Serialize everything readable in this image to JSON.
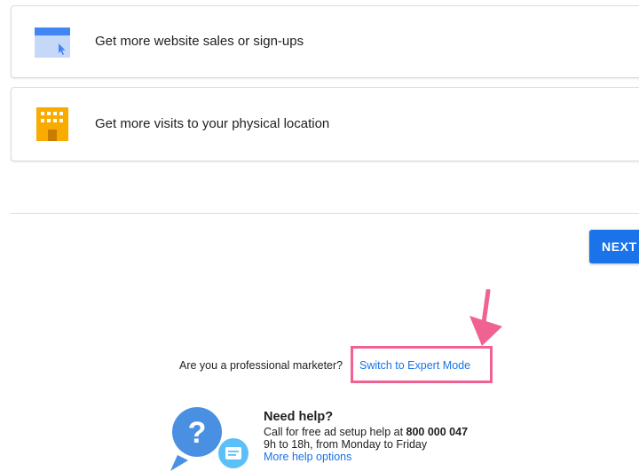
{
  "goals": [
    {
      "label": "Get more website sales or sign-ups",
      "icon": "website-icon"
    },
    {
      "label": "Get more visits to your physical location",
      "icon": "store-icon"
    }
  ],
  "next_button": {
    "label": "NEXT"
  },
  "expert_prompt": {
    "question": "Are you a professional marketer?",
    "link": "Switch to Expert Mode"
  },
  "help": {
    "title": "Need help?",
    "call_prefix": "Call for free ad setup help at ",
    "phone": "800 000 047",
    "hours": "9h to 18h, from Monday to Friday",
    "more_link": "More help options",
    "icon": "help-question-icon"
  },
  "colors": {
    "accent": "#1a73e8",
    "highlight": "#f06292",
    "store_yellow": "#f9ab00",
    "help_blue": "#4a90e2",
    "chat_blue": "#5bc0f8"
  }
}
